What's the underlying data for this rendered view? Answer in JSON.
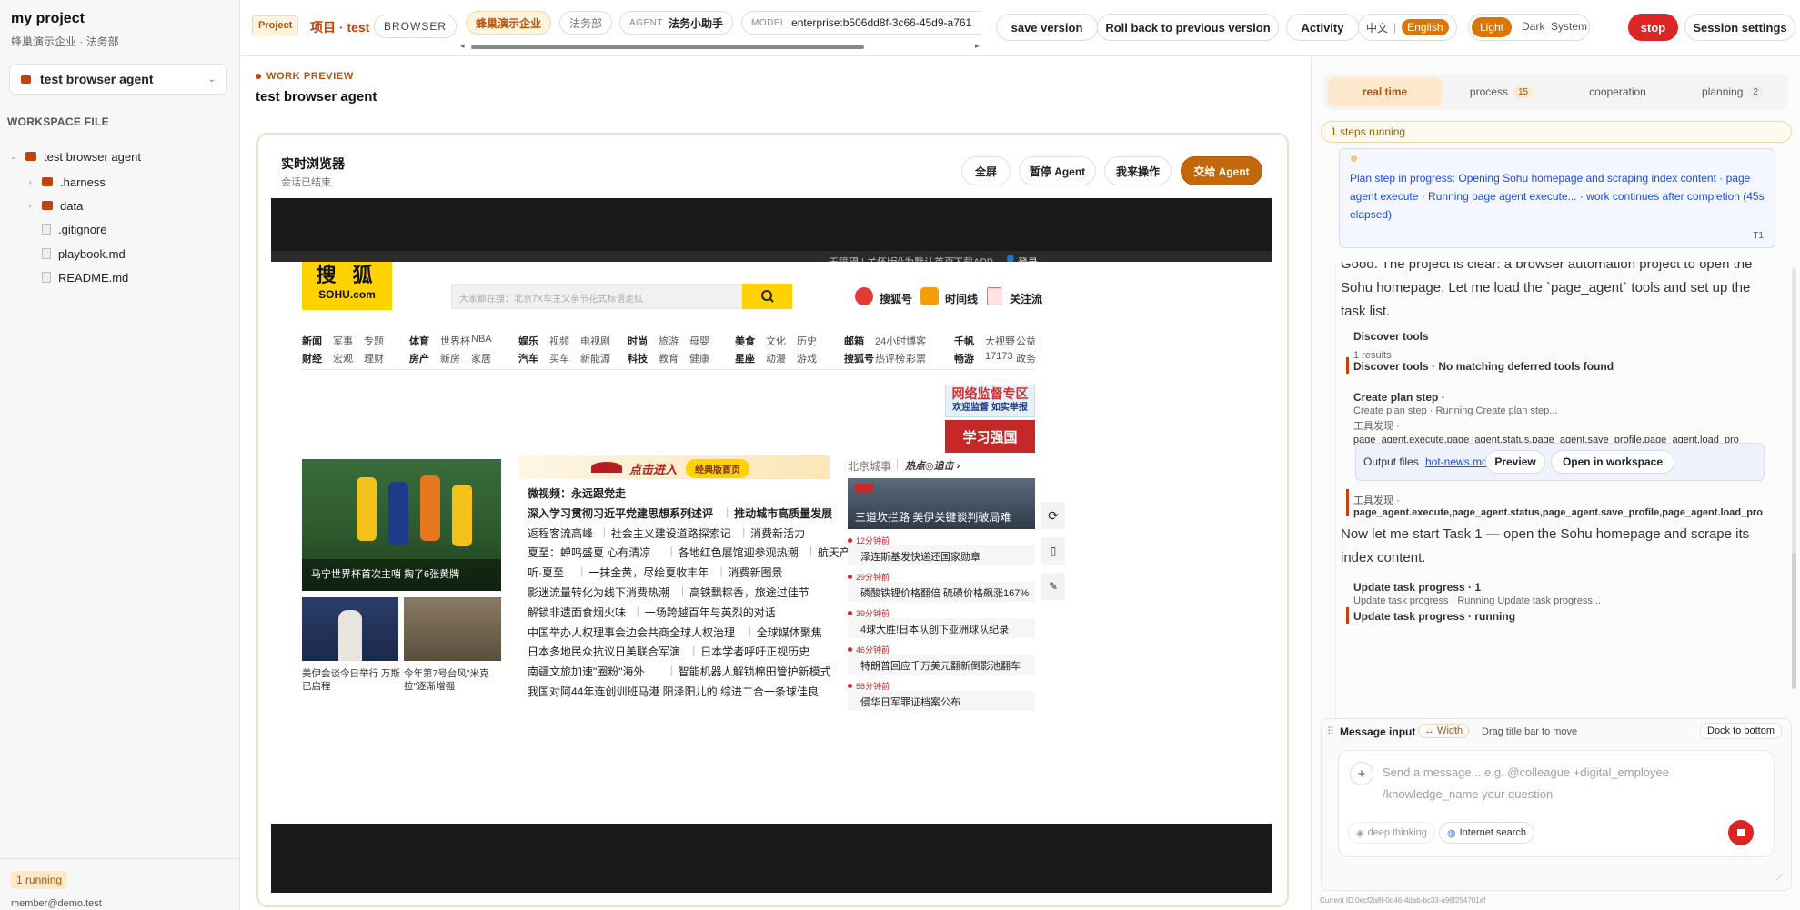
{
  "sidebar": {
    "project_title": "my project",
    "project_sub": "蜂巢演示企业 · 法务部",
    "agent_select": "test browser agent",
    "workspace_label": "WORKSPACE FILE",
    "tree": [
      {
        "label": "test browser agent",
        "type": "folder-open"
      },
      {
        "label": ".harness",
        "type": "folder"
      },
      {
        "label": "data",
        "type": "folder"
      },
      {
        "label": ".gitignore",
        "type": "file"
      },
      {
        "label": "playbook.md",
        "type": "file"
      },
      {
        "label": "README.md",
        "type": "file"
      }
    ],
    "running_badge": "1 running",
    "user_email": "member@demo.test"
  },
  "topbar": {
    "project_tag": "Project",
    "project_name": "项目 · test",
    "mode": "BROWSER",
    "org": "蜂巢演示企业",
    "dept": "法务部",
    "agent_prefix": "AGENT",
    "agent_name": "法务小助手",
    "model_prefix": "MODEL",
    "model_value": "enterprise:b506dd8f-3c66-45d9-a761",
    "save_version": "save version",
    "rollback": "Roll back to previous version",
    "activity": "Activity",
    "lang_zh": "中文",
    "lang_sep": "|",
    "lang_en": "English",
    "theme_light": "Light",
    "theme_dark": "Dark",
    "theme_system": "System",
    "stop": "stop",
    "session_settings": "Session settings"
  },
  "work_preview": {
    "label": "WORK PREVIEW",
    "title": "test browser agent"
  },
  "browser": {
    "title": "实时浏览器",
    "subtitle": "会话已结束",
    "fullscreen": "全屏",
    "pause_agent": "暂停 Agent",
    "take_over": "我来操作",
    "hand_to_agent": "交给 Agent"
  },
  "sohu": {
    "top_links": [
      "无障碍 | 关怀版",
      "设为默认首页",
      "下载APP",
      "登录"
    ],
    "logo_l1": "搜 狐",
    "logo_l2": "SOHU.com",
    "search_placeholder": "大家都在搜：北京7X车主父亲节花式标语走红",
    "right_links": [
      "搜狐号",
      "时间线",
      "关注流"
    ],
    "nav_groups": [
      {
        "r1": [
          "新闻",
          "军事",
          "专题"
        ],
        "r2": [
          "财经",
          "宏观",
          "理财"
        ]
      },
      {
        "r1": [
          "体育",
          "世界杯",
          "NBA"
        ],
        "r2": [
          "房产",
          "新房",
          "家居"
        ]
      },
      {
        "r1": [
          "娱乐",
          "视频",
          "电视剧"
        ],
        "r2": [
          "汽车",
          "买车",
          "新能源"
        ]
      },
      {
        "r1": [
          "时尚",
          "旅游",
          "母婴"
        ],
        "r2": [
          "科技",
          "教育",
          "健康"
        ]
      },
      {
        "r1": [
          "美食",
          "文化",
          "历史"
        ],
        "r2": [
          "星座",
          "动漫",
          "游戏"
        ]
      },
      {
        "r1": [
          "邮箱",
          "24小时",
          "博客"
        ],
        "r2": [
          "搜狐号",
          "热评榜",
          "彩票"
        ]
      },
      {
        "r1": [
          "千帆",
          "大视野",
          "公益"
        ],
        "r2": [
          "畅游",
          "17173",
          "政务"
        ]
      }
    ],
    "net_banner_l1": "网络监督专区",
    "net_banner_l2": "欢迎监督 如实举报",
    "xuexi": "学习强国",
    "main_caption": "马宁世界杯首次主哨 掏了6张黄牌",
    "thumb1": "美伊会谈今日举行 万斯已启程",
    "thumb2": "今年第7号台风\"米克拉\"逐渐增强",
    "banner_text": "点击进入",
    "banner_btn": "经典版首页",
    "headlines": [
      [
        "微视频：永远跟党走"
      ],
      [
        "深入学习贯彻习近平党建思想系列述评",
        "推动城市高质量发展"
      ],
      [
        "返程客流高峰",
        "社会主义建设道路探索记",
        "消费新活力"
      ],
      [
        "夏至：蝉鸣盛夏 心有清凉",
        "各地红色展馆迎参观热潮",
        "航天产业"
      ],
      [
        "听·夏至",
        "一抹金黄，尽绘夏收丰年",
        "消费新图景"
      ],
      [
        "影迷流量转化为线下消费热潮",
        "高铁飘粽香，旅途过佳节"
      ],
      [
        "解锁非遗面食烟火味",
        "一场跨越百年与英烈的对话"
      ],
      [
        "中国举办人权理事会边会共商全球人权治理",
        "全球媒体聚焦"
      ],
      [
        "日本多地民众抗议日美联合军演",
        "日本学者呼吁正视历史"
      ],
      [
        "南疆文旅加速\"圈粉\"海外",
        "智能机器人解锁棉田管护新模式"
      ],
      [
        "我国对阿44年连创训班马港 阳泽阳儿的 综进二合一条球佳良"
      ]
    ],
    "city_label": "北京城事",
    "hot_label": "热点◎追击 ›",
    "city_caption": "三道坎拦路 美伊关键谈判破局难",
    "news": [
      {
        "time": "12分钟前",
        "text": "泽连斯基发快递还国家勋章"
      },
      {
        "time": "29分钟前",
        "text": "磷酸铁锂价格翻倍 硫磺价格飙涨167%"
      },
      {
        "time": "39分钟前",
        "text": "4球大胜!日本队创下亚洲球队纪录"
      },
      {
        "time": "46分钟前",
        "text": "特朗普回应千万美元翻新倒影池翻车"
      },
      {
        "time": "58分钟前",
        "text": "侵华日军罪证档案公布"
      }
    ]
  },
  "right_panel": {
    "tabs": [
      {
        "label": "real time",
        "count": ""
      },
      {
        "label": "process",
        "count": "15"
      },
      {
        "label": "cooperation",
        "count": ""
      },
      {
        "label": "planning",
        "count": "2"
      }
    ],
    "steps_running": "1 steps running",
    "plan_text": "Plan step in progress: Opening Sohu homepage and scraping index content · page agent execute · Running page agent execute... · work continues after completion (45s elapsed)",
    "plan_tag": "T1",
    "msg1": "Good. The project is clear: a browser automation project to open the Sohu homepage. Let me load the `page_agent` tools and set up the task list.",
    "tool1_title": "Discover tools",
    "tool1_sub": "1 results",
    "tool2_title": "Discover tools · No matching deferred tools found",
    "tool3_title": "Create plan step ·",
    "tool3_sub1": "Create plan step · Running Create plan step...",
    "tool3_sub2": "工具发现 ·",
    "tool3_sub3": "page_agent.execute,page_agent.status,page_agent.save_profile,page_agent.load_pro",
    "output_files_label": "Output files",
    "output_file": "hot-news.md",
    "preview_btn": "Preview",
    "open_ws_btn": "Open in workspace",
    "tool4_title": "工具发现 ·",
    "tool4_sub": "page_agent.execute,page_agent.status,page_agent.save_profile,page_agent.load_pro",
    "msg2": "Now let me start Task 1 — open the Sohu homepage and scrape its index content.",
    "tool5_title": "Update task progress · 1",
    "tool5_sub": "Update task progress · Running Update task progress...",
    "tool6_title": "Update task progress · running",
    "composer_title": "Message input",
    "width_btn": "↔ Width",
    "drag_hint": "Drag title bar to move",
    "dock_btn": "Dock to bottom",
    "placeholder": "Send a message... e.g. @colleague +digital_employee /knowledge_name your question",
    "deep_thinking": "deep thinking",
    "internet_search": "Internet search",
    "current_id": "Current ID:0ecf2a8f-0d46-4dab-bc33-a96f254701ef"
  }
}
